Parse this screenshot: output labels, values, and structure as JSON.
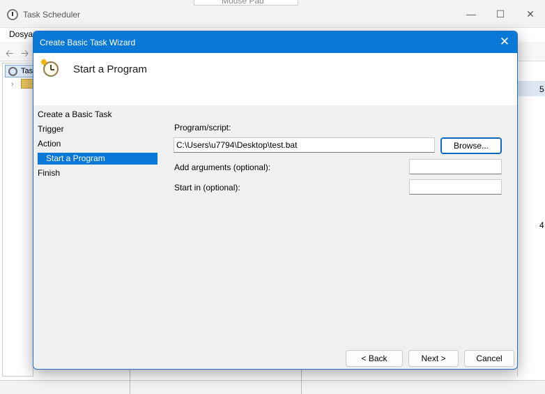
{
  "background_window": {
    "title": "Task Scheduler",
    "tab_label": "Mouse Pad",
    "menu_first": "Dosya",
    "tree_item": "Tas",
    "right_values": [
      "5",
      "4"
    ]
  },
  "dialog": {
    "title": "Create Basic Task Wizard",
    "header_title": "Start a Program",
    "steps": [
      {
        "label": "Create a Basic Task"
      },
      {
        "label": "Trigger"
      },
      {
        "label": "Action"
      },
      {
        "label": "Start a Program"
      },
      {
        "label": "Finish"
      }
    ],
    "active_step": "Start a Program",
    "program_label": "Program/script:",
    "program_value": "C:\\Users\\u7794\\Desktop\\test.bat",
    "browse_label": "Browse...",
    "arguments_label": "Add arguments (optional):",
    "arguments_value": "",
    "startin_label": "Start in (optional):",
    "startin_value": "",
    "back_label": "< Back",
    "next_label": "Next >",
    "cancel_label": "Cancel"
  }
}
